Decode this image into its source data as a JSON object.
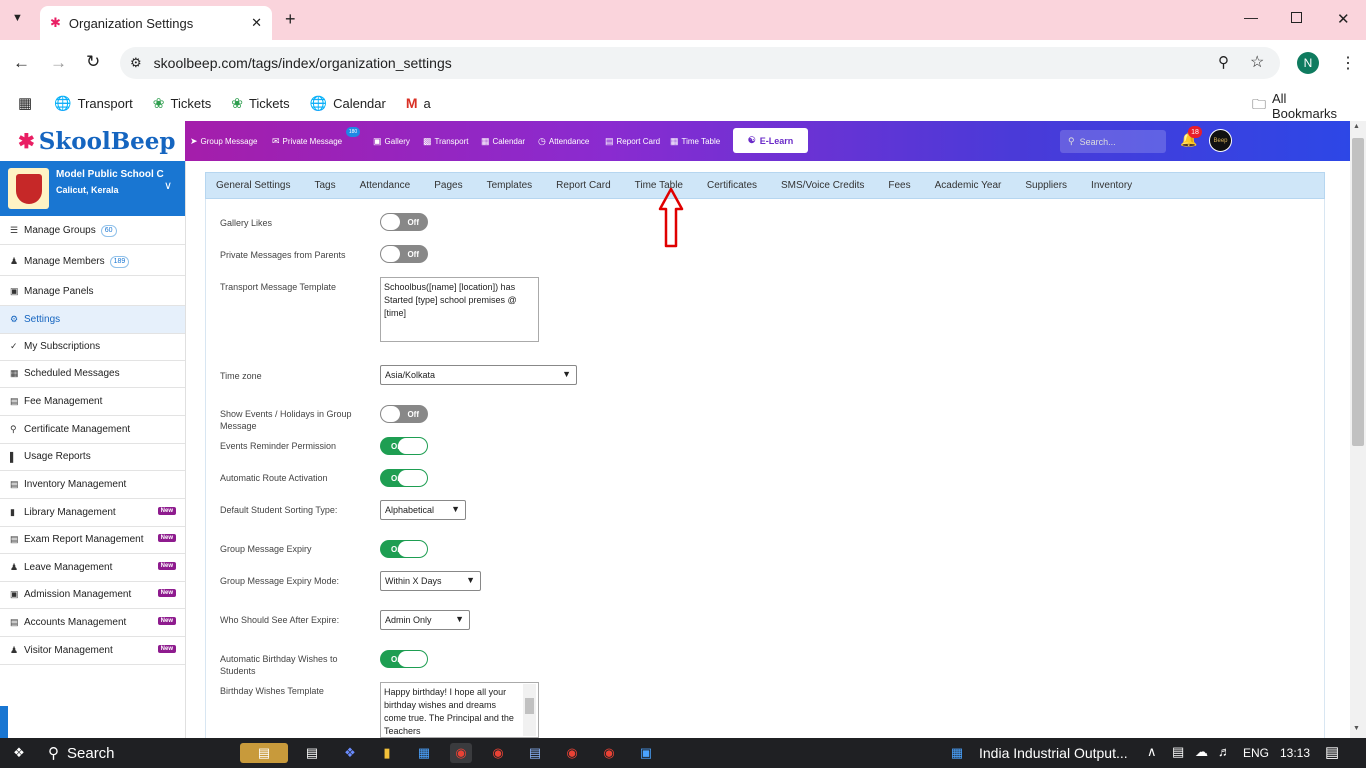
{
  "browser": {
    "tab_title": "Organization Settings",
    "url": "skoolbeep.com/tags/index/organization_settings",
    "profile_initial": "N",
    "bookmarks": [
      "Transport",
      "Tickets",
      "Tickets",
      "Calendar",
      "a"
    ],
    "all_bookmarks": "All Bookmarks"
  },
  "app": {
    "logo": "SkoolBeep",
    "nav": [
      "Group Message",
      "Private Message",
      "Gallery",
      "Transport",
      "Calendar",
      "Attendance",
      "Report Card",
      "Time Table"
    ],
    "private_badge": "180",
    "elearn": "E-Learn",
    "search_placeholder": "Search...",
    "notif_count": "18",
    "avatar_text": "Beep"
  },
  "school": {
    "name": "Model Public School C",
    "city": "Calicut, Kerala"
  },
  "sidebar": [
    {
      "label": "Manage Groups",
      "count": "60"
    },
    {
      "label": "Manage Members",
      "count": "189"
    },
    {
      "label": "Manage Panels"
    },
    {
      "label": "Settings"
    },
    {
      "label": "My Subscriptions"
    },
    {
      "label": "Scheduled Messages"
    },
    {
      "label": "Fee Management"
    },
    {
      "label": "Certificate Management"
    },
    {
      "label": "Usage Reports"
    },
    {
      "label": "Inventory Management"
    },
    {
      "label": "Library Management",
      "badge": "New"
    },
    {
      "label": "Exam Report Management",
      "badge": "New"
    },
    {
      "label": "Leave Management",
      "badge": "New"
    },
    {
      "label": "Admission Management",
      "badge": "New"
    },
    {
      "label": "Accounts Management",
      "badge": "New"
    },
    {
      "label": "Visitor Management",
      "badge": "New"
    }
  ],
  "settings_tabs": [
    "General Settings",
    "Tags",
    "Attendance",
    "Pages",
    "Templates",
    "Report Card",
    "Time Table",
    "Certificates",
    "SMS/Voice Credits",
    "Fees",
    "Academic Year",
    "Suppliers",
    "Inventory"
  ],
  "form": {
    "gallery_likes": {
      "label": "Gallery Likes",
      "state": "Off"
    },
    "private_messages": {
      "label": "Private Messages from Parents",
      "state": "Off"
    },
    "transport_template": {
      "label": "Transport Message Template",
      "value": "Schoolbus([name] [location]) has Started [type] school premises @ [time]"
    },
    "time_zone": {
      "label": "Time zone",
      "value": "Asia/Kolkata"
    },
    "show_events": {
      "label": "Show Events / Holidays in Group Message",
      "state": "Off"
    },
    "events_reminder": {
      "label": "Events Reminder Permission",
      "state": "On"
    },
    "auto_route": {
      "label": "Automatic Route Activation",
      "state": "On"
    },
    "sorting": {
      "label": "Default Student Sorting Type:",
      "value": "Alphabetical"
    },
    "msg_expiry": {
      "label": "Group Message Expiry",
      "state": "On"
    },
    "expiry_mode": {
      "label": "Group Message Expiry Mode:",
      "value": "Within X Days"
    },
    "who_see": {
      "label": "Who Should See After Expire:",
      "value": "Admin Only"
    },
    "birthday_wishes": {
      "label": "Automatic Birthday Wishes to Students",
      "state": "On"
    },
    "birthday_template": {
      "label": "Birthday Wishes Template",
      "value": "Happy birthday! I hope all your birthday wishes and dreams come true. The Principal and the Teachers"
    }
  },
  "taskbar": {
    "search": "Search",
    "news": "India Industrial Output...",
    "lang": "ENG",
    "time": "13:13"
  },
  "colors": {
    "accent": "#1976d2",
    "toggle_on": "#1e9e52",
    "annotation_arrow": "#e00000"
  }
}
